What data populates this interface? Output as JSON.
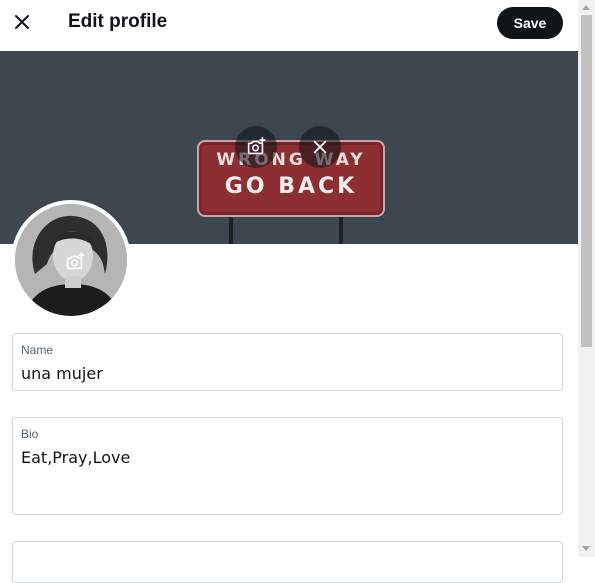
{
  "header": {
    "title": "Edit profile",
    "save_label": "Save",
    "close_icon": "close-icon"
  },
  "banner": {
    "sign_line1": "WRONG WAY",
    "sign_line2": "GO BACK",
    "add_photo_icon": "camera-plus-icon",
    "remove_icon": "close-icon"
  },
  "avatar": {
    "add_photo_icon": "camera-plus-icon"
  },
  "fields": {
    "name": {
      "label": "Name",
      "value": "una mujer"
    },
    "bio": {
      "label": "Bio",
      "value": "Eat,Pray,Love"
    }
  },
  "colors": {
    "primary_text": "#0f1419",
    "secondary_text": "#536471",
    "border": "#cfd9de",
    "banner_bg": "#3e4650",
    "sign_red": "#8d2e33"
  }
}
